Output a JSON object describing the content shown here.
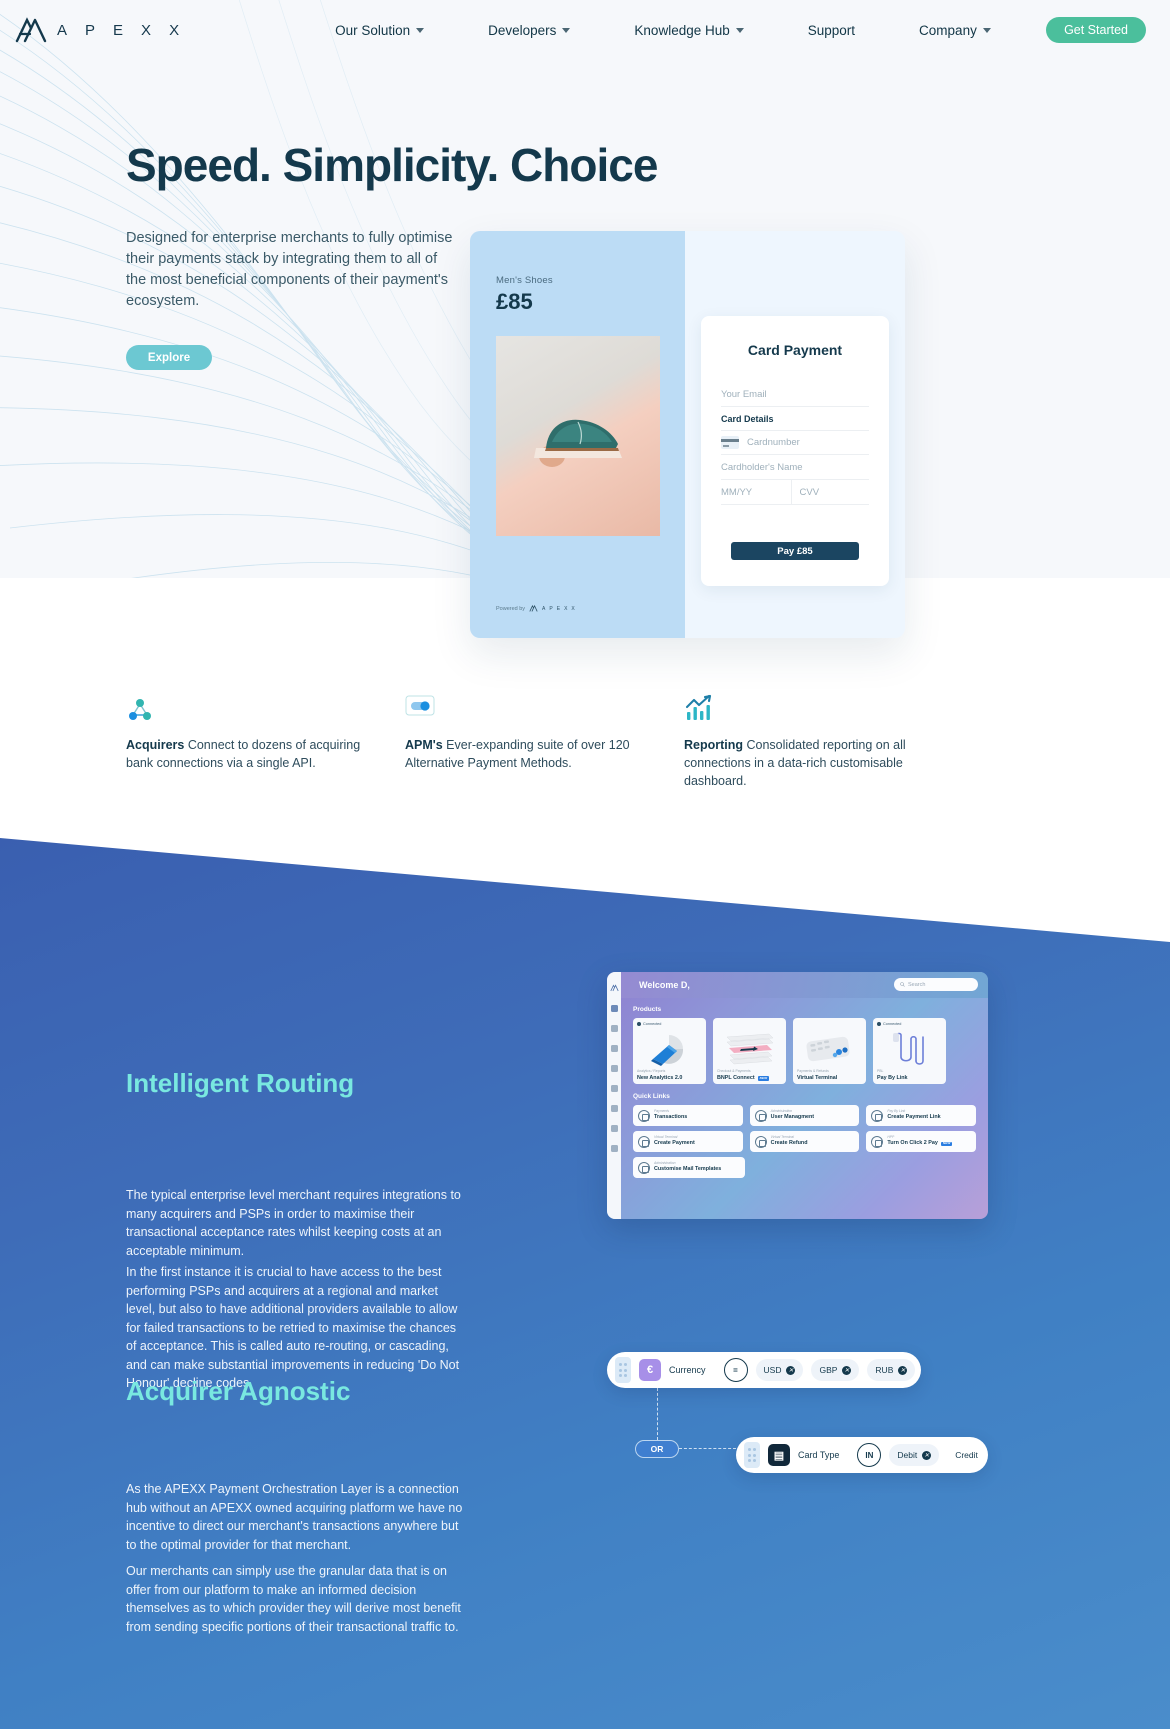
{
  "nav": {
    "logo_letters": [
      "A",
      "P",
      "E",
      "X",
      "X"
    ],
    "logo_name": "APEXX",
    "items": [
      {
        "label": "Our Solution",
        "has_caret": true
      },
      {
        "label": "Developers",
        "has_caret": true
      },
      {
        "label": "Knowledge Hub",
        "has_caret": true
      },
      {
        "label": "Support",
        "has_caret": false
      },
      {
        "label": "Company",
        "has_caret": true
      }
    ],
    "cta": "Get Started"
  },
  "hero": {
    "title": "Speed. Simplicity. Choice",
    "subtitle": "Designed for enterprise merchants to fully optimise their payments stack by integrating them to all of the most beneficial components of their payment's ecosystem.",
    "button": "Explore"
  },
  "checkout": {
    "category": "Men's Shoes",
    "price": "£85",
    "powered_by": "Powered by",
    "powered_letters": [
      "A",
      "P",
      "E",
      "X",
      "X"
    ],
    "form": {
      "title": "Card Payment",
      "email_placeholder": "Your Email",
      "card_details_label": "Card Details",
      "cardnumber_placeholder": "Cardnumber",
      "cardholder_placeholder": "Cardholder's Name",
      "expiry_placeholder": "MM/YY",
      "cvv_placeholder": "CVV",
      "pay_button": "Pay £85"
    }
  },
  "features": [
    {
      "icon": "network-nodes-icon",
      "bold": "Acquirers",
      "text": " Connect to dozens of acquiring bank connections via a single API."
    },
    {
      "icon": "toggle-switch-icon",
      "bold": "APM's",
      "text": " Ever-expanding suite of over 120 Alternative Payment Methods."
    },
    {
      "icon": "bar-chart-icon",
      "bold": "Reporting",
      "text": " Consolidated reporting on all connections in a data-rich customisable dashboard."
    }
  ],
  "intelligent_routing": {
    "title": "Intelligent Routing",
    "paragraph1": "The typical enterprise level merchant requires integrations to many acquirers and PSPs in order to maximise their transactional acceptance rates whilst keeping costs at an acceptable minimum.",
    "paragraph2": "In the first instance it is crucial to have access to the best performing PSPs and acquirers at a regional and market level, but also to have additional providers available to allow for failed transactions to be retried to maximise the chances of acceptance. This is called auto re-routing, or cascading, and can make substantial improvements in reducing 'Do Not Honour' decline codes."
  },
  "dashboard": {
    "welcome": "Welcome D,",
    "search_placeholder": "Search",
    "products_heading": "Products",
    "quick_links_heading": "Quick Links",
    "products": [
      {
        "status": "Connected",
        "category": "Analytics / Reports",
        "name": "New Analytics 2.0",
        "badge": ""
      },
      {
        "status": "",
        "category": "Checkout & Payments",
        "name": "BNPL Connect",
        "badge": "NEW"
      },
      {
        "status": "",
        "category": "Payments & Refunds",
        "name": "Virtual Terminal",
        "badge": ""
      },
      {
        "status": "Connected",
        "category": "PBL",
        "name": "Pay By Link",
        "badge": ""
      }
    ],
    "quick_links": [
      {
        "category": "Payments",
        "name": "Transactions",
        "badge": ""
      },
      {
        "category": "Administration",
        "name": "User Managment",
        "badge": ""
      },
      {
        "category": "Pay By Link",
        "name": "Create Payment Link",
        "badge": ""
      },
      {
        "category": "Virtual Terminal",
        "name": "Create Payment",
        "badge": ""
      },
      {
        "category": "Virtual Terminal",
        "name": "Create Refund",
        "badge": ""
      },
      {
        "category": "HPP",
        "name": "Turn On Click 2 Pay",
        "badge": "NEW"
      },
      {
        "category": "Administration",
        "name": "Customise Mail Templates",
        "badge": ""
      }
    ]
  },
  "acquirer_agnostic": {
    "title": "Acquirer Agnostic",
    "paragraph1": "As the APEXX Payment Orchestration Layer is a connection hub without an APEXX owned acquiring platform we have no incentive to direct our merchant's transactions anywhere but to the optimal provider for that merchant.",
    "paragraph2": "Our merchants can simply use the granular data that is on offer from our platform to make an informed decision themselves as to which provider they will derive most benefit from sending specific portions of their transactional traffic to."
  },
  "rules": {
    "connector": "OR",
    "rule1": {
      "icon_glyph": "€",
      "icon_name": "currency-euro-icon",
      "field": "Currency",
      "operator": "=",
      "values": [
        "USD",
        "GBP",
        "RUB"
      ]
    },
    "rule2": {
      "icon_glyph": "▤",
      "icon_name": "credit-card-icon",
      "field": "Card Type",
      "operator": "IN",
      "values": [
        "Debit",
        "Credit"
      ]
    }
  },
  "colors": {
    "navy": "#14394c",
    "teal_cta": "#4bbf9c",
    "explore": "#6cc8d2",
    "heading_mint": "#79e8e0",
    "blue_section": "#4080c4",
    "checkout_panel": "#bcdcf5"
  }
}
